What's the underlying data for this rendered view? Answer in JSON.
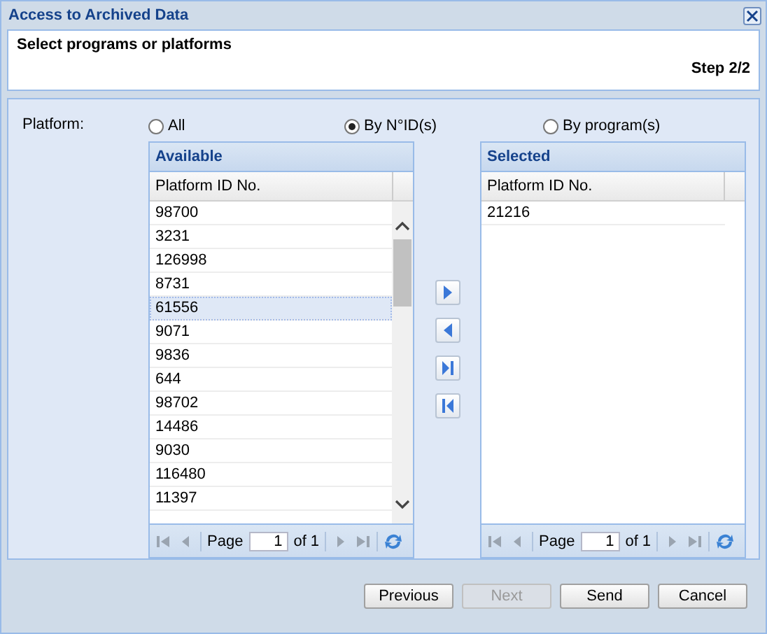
{
  "window": {
    "title": "Access to Archived Data"
  },
  "header": {
    "heading": "Select programs or platforms",
    "step": "Step 2/2"
  },
  "platform": {
    "label": "Platform:",
    "options": [
      {
        "label": "All",
        "selected": false
      },
      {
        "label": "By N°ID(s)",
        "selected": true
      },
      {
        "label": "By program(s)",
        "selected": false
      }
    ]
  },
  "available": {
    "title": "Available",
    "column": "Platform ID No.",
    "rows": [
      {
        "id": "98700",
        "selected": false
      },
      {
        "id": "3231",
        "selected": false
      },
      {
        "id": "126998",
        "selected": false
      },
      {
        "id": "8731",
        "selected": false
      },
      {
        "id": "61556",
        "selected": true
      },
      {
        "id": "9071",
        "selected": false
      },
      {
        "id": "9836",
        "selected": false
      },
      {
        "id": "644",
        "selected": false
      },
      {
        "id": "98702",
        "selected": false
      },
      {
        "id": "14486",
        "selected": false
      },
      {
        "id": "9030",
        "selected": false
      },
      {
        "id": "116480",
        "selected": false
      },
      {
        "id": "11397",
        "selected": false
      }
    ],
    "pager": {
      "label": "Page",
      "page": "1",
      "of": "of 1"
    }
  },
  "selected": {
    "title": "Selected",
    "column": "Platform ID No.",
    "rows": [
      {
        "id": "21216",
        "selected": false
      }
    ],
    "pager": {
      "label": "Page",
      "page": "1",
      "of": "of 1"
    }
  },
  "buttons": [
    {
      "label": "Previous",
      "disabled": false
    },
    {
      "label": "Next",
      "disabled": true
    },
    {
      "label": "Send",
      "disabled": false
    },
    {
      "label": "Cancel",
      "disabled": false
    }
  ]
}
